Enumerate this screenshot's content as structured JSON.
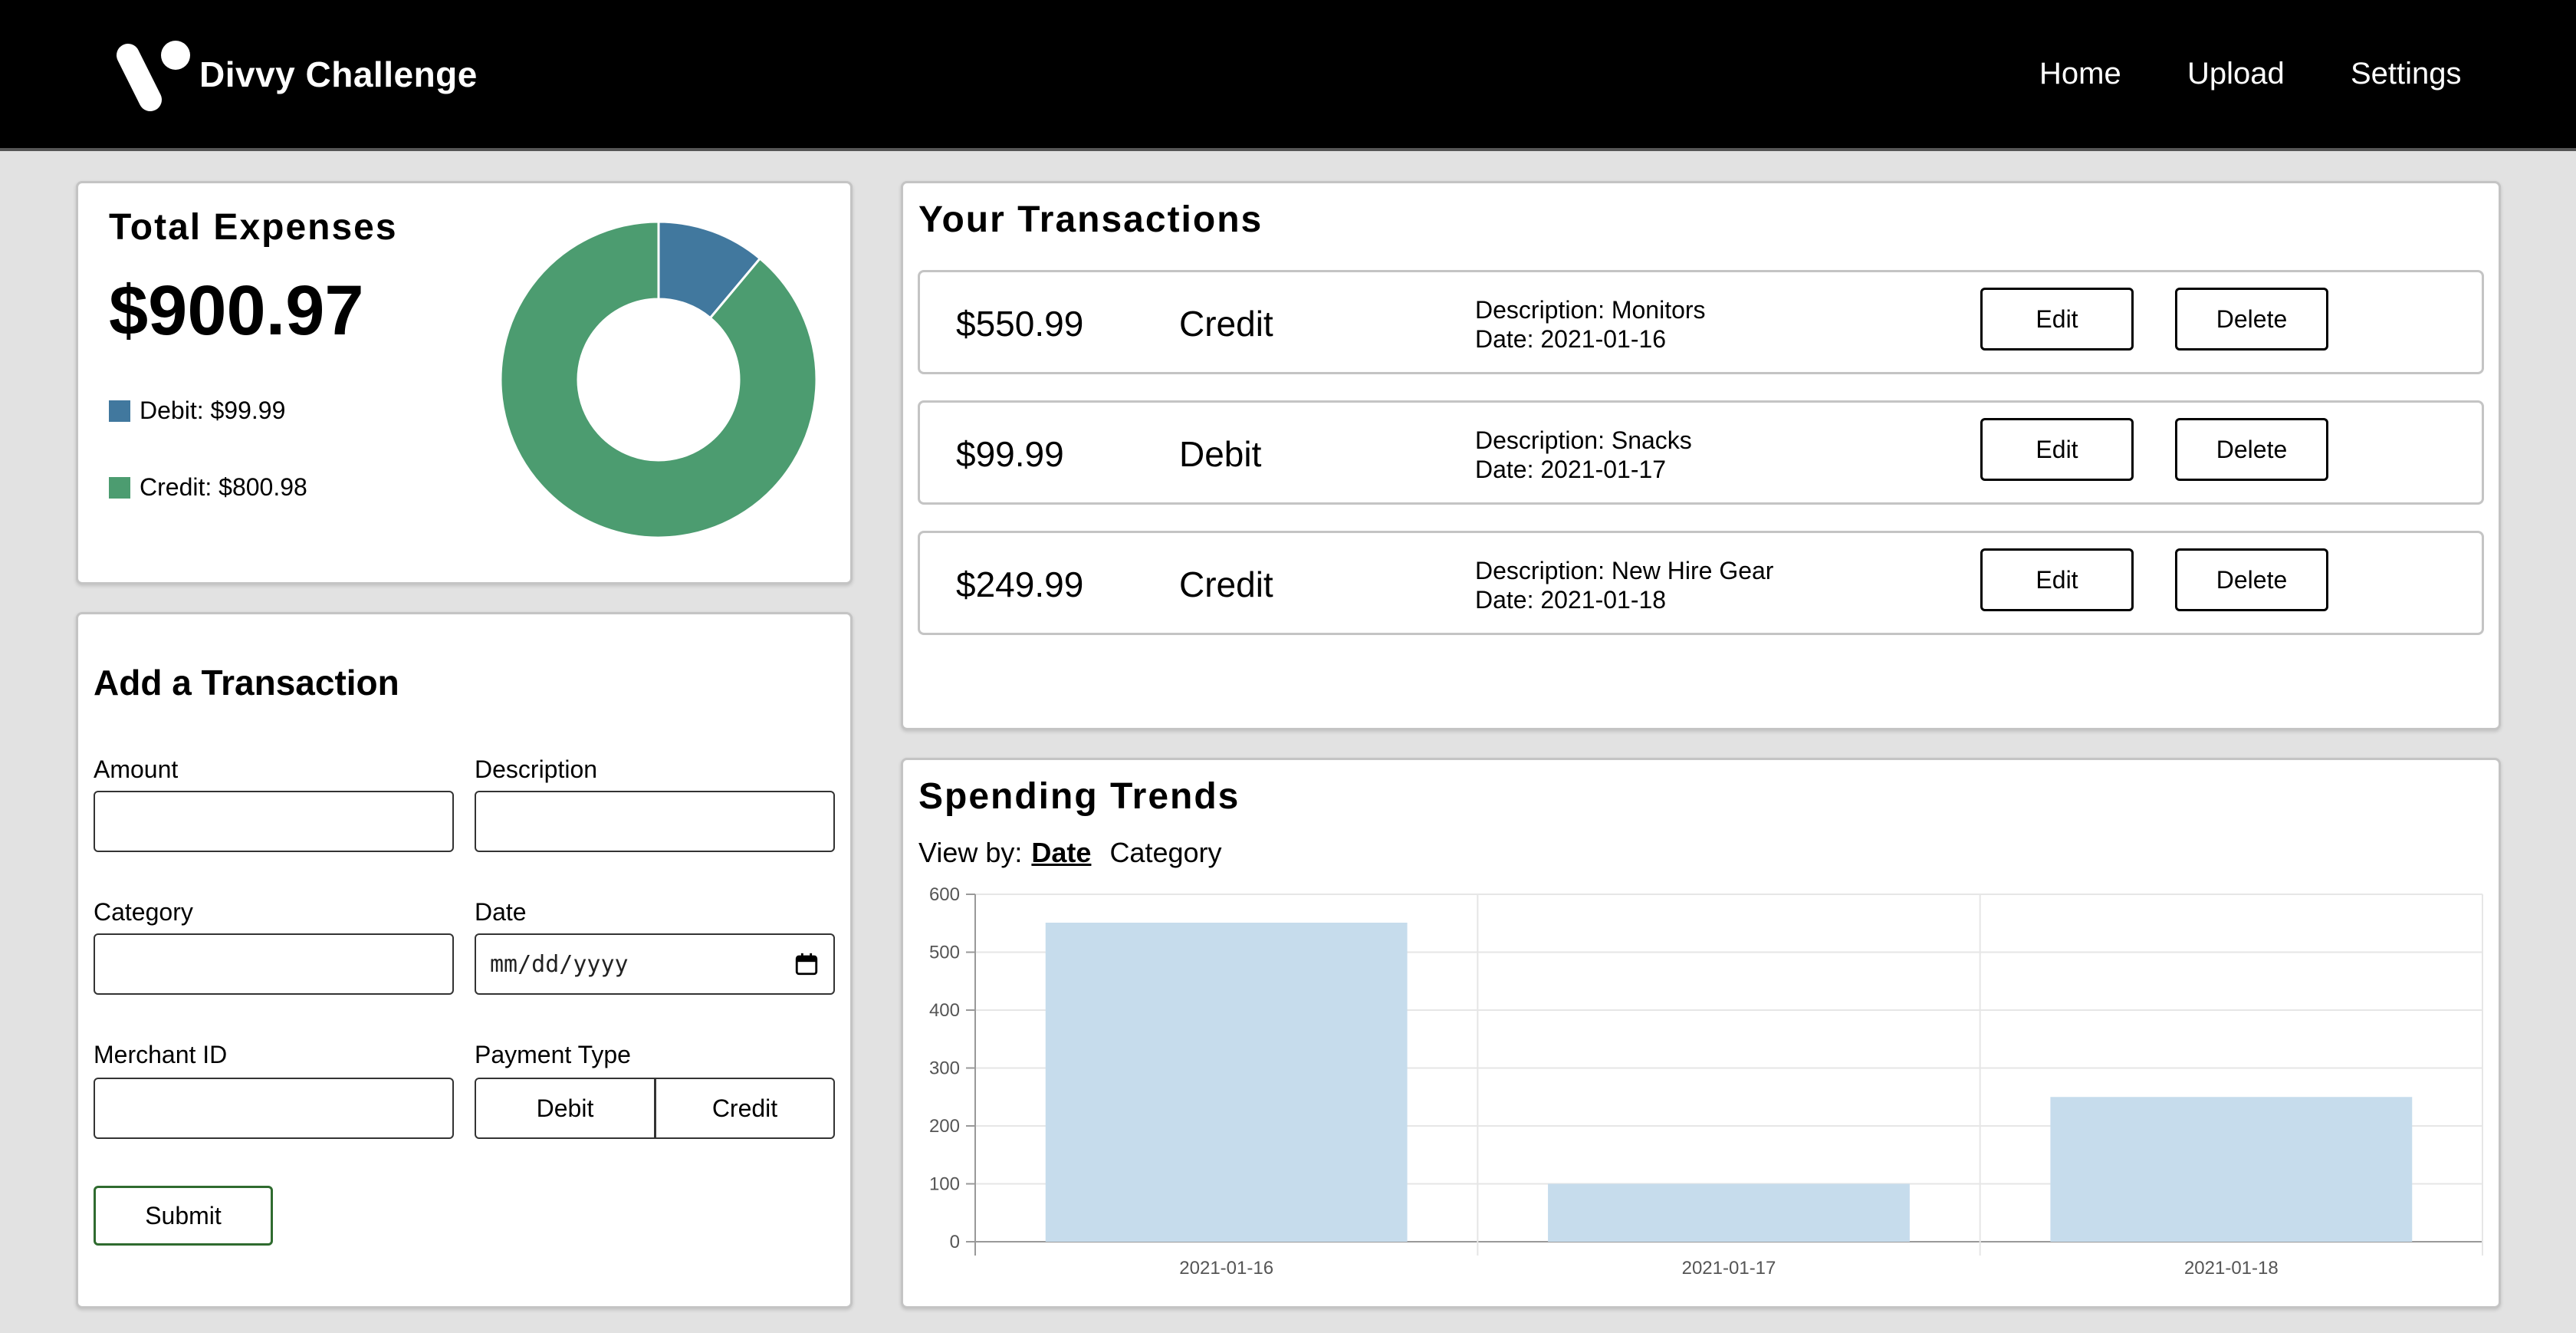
{
  "header": {
    "brand": "Divvy Challenge",
    "nav": [
      "Home",
      "Upload",
      "Settings"
    ]
  },
  "expenses": {
    "title": "Total Expenses",
    "total": "$900.97",
    "legend": [
      {
        "label": "Debit: $99.99",
        "color": "#41789e"
      },
      {
        "label": "Credit: $800.98",
        "color": "#4c9c70"
      }
    ]
  },
  "add_form": {
    "title": "Add a Transaction",
    "labels": {
      "amount": "Amount",
      "description": "Description",
      "category": "Category",
      "date": "Date",
      "merchant": "Merchant ID",
      "payment": "Payment Type"
    },
    "date_placeholder": "mm/dd/yyyy",
    "payment_options": [
      "Debit",
      "Credit"
    ],
    "submit_label": "Submit"
  },
  "transactions": {
    "title": "Your Transactions",
    "edit_label": "Edit",
    "delete_label": "Delete",
    "rows": [
      {
        "amount": "$550.99",
        "type": "Credit",
        "description": "Description: Monitors",
        "date": "Date: 2021-01-16"
      },
      {
        "amount": "$99.99",
        "type": "Debit",
        "description": "Description: Snacks",
        "date": "Date: 2021-01-17"
      },
      {
        "amount": "$249.99",
        "type": "Credit",
        "description": "Description: New Hire Gear",
        "date": "Date: 2021-01-18"
      }
    ]
  },
  "trends": {
    "title": "Spending Trends",
    "view_by_label": "View by:",
    "options": [
      "Date",
      "Category"
    ],
    "active_option": "Date"
  },
  "chart_data": [
    {
      "type": "pie",
      "categories": [
        "Debit",
        "Credit"
      ],
      "values": [
        99.99,
        800.98
      ],
      "colors": [
        "#41789e",
        "#4c9c70"
      ],
      "donut": true
    },
    {
      "type": "bar",
      "categories": [
        "2021-01-16",
        "2021-01-17",
        "2021-01-18"
      ],
      "values": [
        550.99,
        99.99,
        249.99
      ],
      "ylim": [
        0,
        600
      ],
      "yticks": [
        0,
        100,
        200,
        300,
        400,
        500,
        600
      ],
      "bar_color": "#c6dcec",
      "grid": true
    }
  ]
}
